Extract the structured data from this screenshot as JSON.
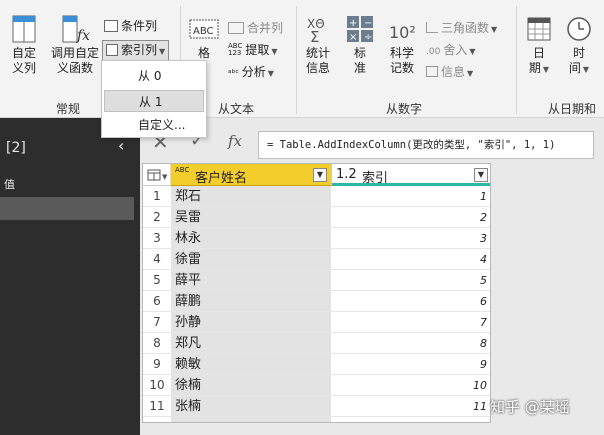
{
  "ribbon": {
    "custom_column": "自定\n义列",
    "invoke_function": "调用自定\n义函数",
    "conditional_column": "条件列",
    "index_column": "索引列",
    "group_general": "常规",
    "group_from_text": "从文本",
    "group_from_number": "从数字",
    "group_from_datetime": "从日期和",
    "merge_columns": "合并列",
    "extract": "提取",
    "parse": "分析",
    "abc_icon": "ABC",
    "abc123_icon": "ABC\n123",
    "statistics": "统计\n信息",
    "standard": "标\n准",
    "scientific": "科学\n记数",
    "trig": "三角函数",
    "rounding": "舍入",
    "information": "信息",
    "date": "日\n期",
    "time": "时\n间",
    "sci_icon_text": "10²",
    "partial_label": "格"
  },
  "menu": {
    "items": [
      "从 0",
      "从 1",
      "自定义..."
    ],
    "highlighted_index": 1
  },
  "left_pane": {
    "title": "[2]",
    "item": "值"
  },
  "formula_bar": {
    "fx": "fx",
    "text": "= Table.AddIndexColumn(更改的类型, \"索引\", 1, 1)"
  },
  "table": {
    "columns": [
      {
        "type_icon": "ABC",
        "name": "客户姓名"
      },
      {
        "type_icon": "1.2",
        "name": "索引"
      }
    ],
    "rows": [
      {
        "n": "1",
        "name": "郑石",
        "idx": "1"
      },
      {
        "n": "2",
        "name": "吴雷",
        "idx": "2"
      },
      {
        "n": "3",
        "name": "林永",
        "idx": "3"
      },
      {
        "n": "4",
        "name": "徐雷",
        "idx": "4"
      },
      {
        "n": "5",
        "name": "薛平",
        "idx": "5"
      },
      {
        "n": "6",
        "name": "薛鹏",
        "idx": "6"
      },
      {
        "n": "7",
        "name": "孙静",
        "idx": "7"
      },
      {
        "n": "8",
        "name": "郑凡",
        "idx": "8"
      },
      {
        "n": "9",
        "name": "赖敏",
        "idx": "9"
      },
      {
        "n": "10",
        "name": "徐楠",
        "idx": "10"
      },
      {
        "n": "11",
        "name": "张楠",
        "idx": "11"
      }
    ]
  },
  "watermark": "知乎 @某瑶",
  "colors": {
    "header_highlight": "#f3cd2b",
    "index_accent": "#2fb7a6",
    "left_pane": "#2d2d2d"
  }
}
